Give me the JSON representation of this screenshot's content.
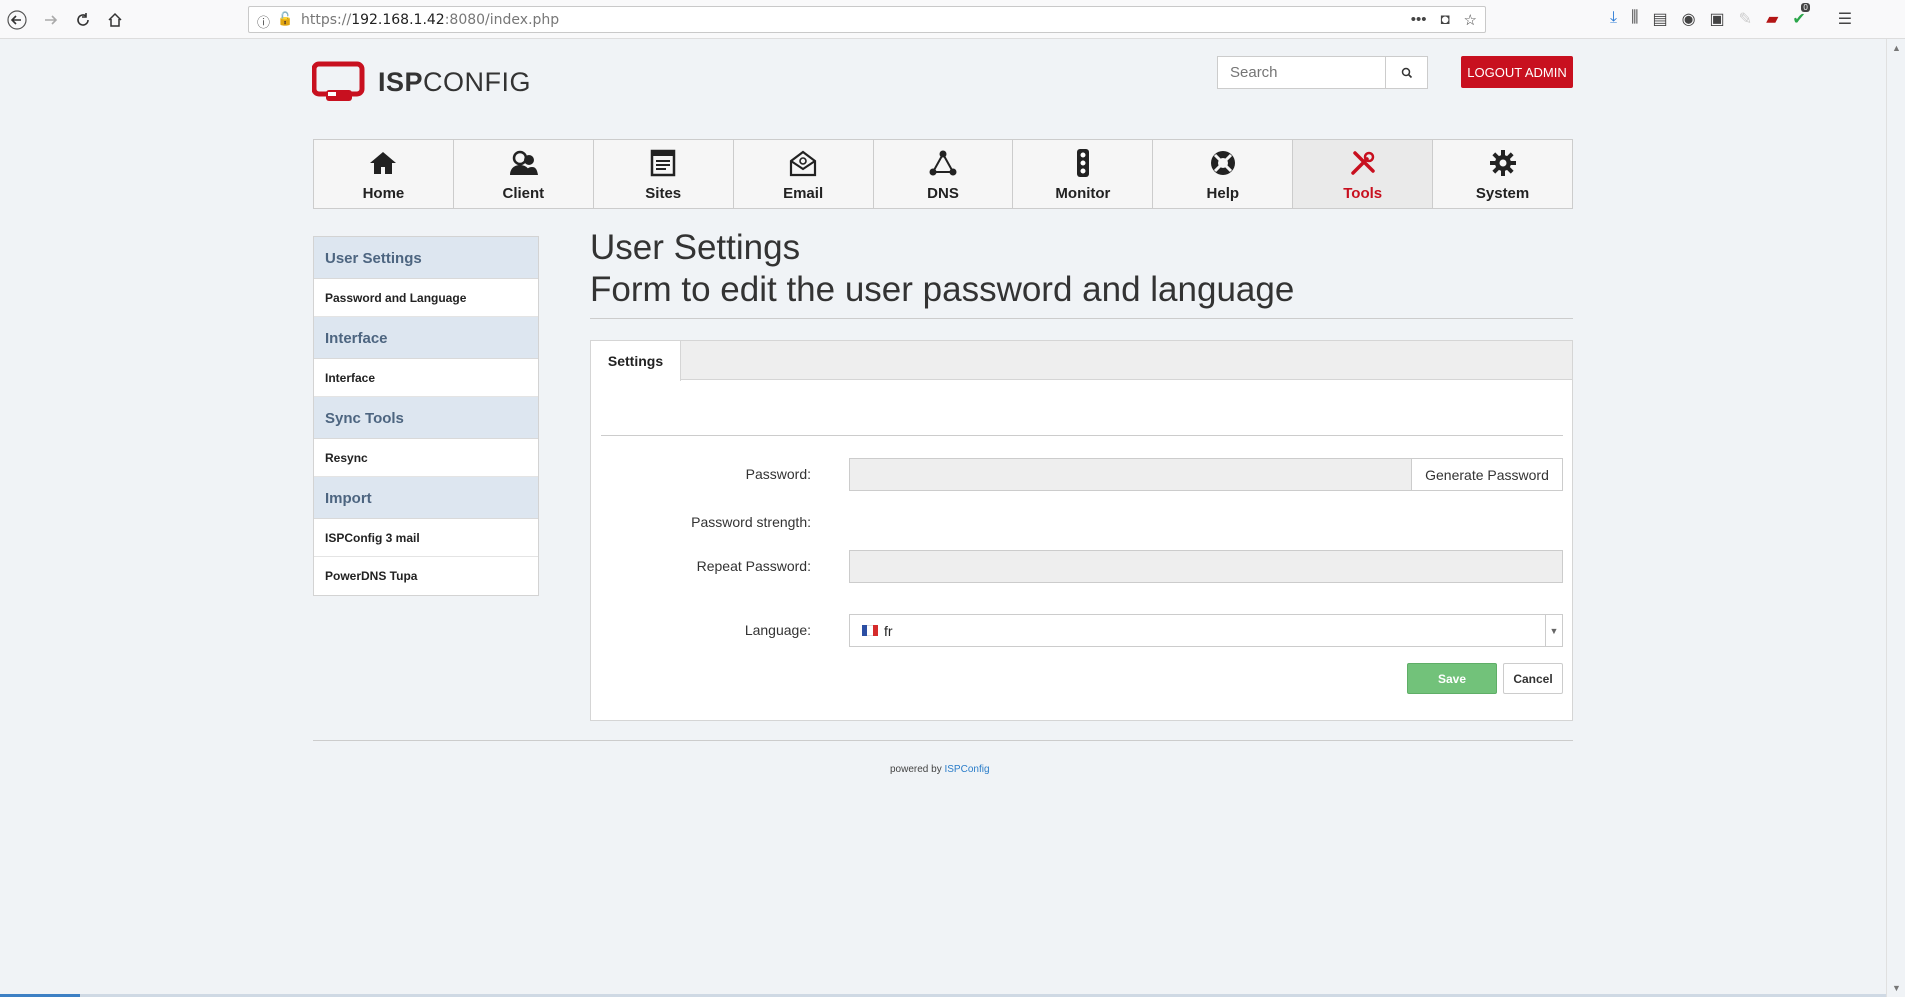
{
  "browser": {
    "url_scheme": "https://",
    "url_host": "192.168.1.42",
    "url_rest": ":8080/index.php",
    "toolbar_badge": "0"
  },
  "header": {
    "logo_bold": "ISP",
    "logo_light": "CONFIG",
    "search_placeholder": "Search",
    "logout_label": "LOGOUT ADMIN"
  },
  "mainnav": [
    {
      "label": "Home",
      "icon": "home-icon"
    },
    {
      "label": "Client",
      "icon": "client-icon"
    },
    {
      "label": "Sites",
      "icon": "sites-icon"
    },
    {
      "label": "Email",
      "icon": "email-icon"
    },
    {
      "label": "DNS",
      "icon": "dns-icon"
    },
    {
      "label": "Monitor",
      "icon": "monitor-icon"
    },
    {
      "label": "Help",
      "icon": "help-icon"
    },
    {
      "label": "Tools",
      "icon": "tools-icon",
      "active": true
    },
    {
      "label": "System",
      "icon": "gear-icon"
    }
  ],
  "sidebar": {
    "sections": [
      {
        "heading": "User Settings",
        "items": [
          "Password and Language"
        ]
      },
      {
        "heading": "Interface",
        "items": [
          "Interface"
        ]
      },
      {
        "heading": "Sync Tools",
        "items": [
          "Resync"
        ]
      },
      {
        "heading": "Import",
        "items": [
          "ISPConfig 3 mail",
          "PowerDNS Tupa"
        ]
      }
    ]
  },
  "page": {
    "title": "User Settings",
    "subtitle": "Form to edit the user password and language"
  },
  "form": {
    "tab_label": "Settings",
    "password_label": "Password:",
    "password_value": "",
    "generate_label": "Generate Password",
    "strength_label": "Password strength:",
    "repeat_label": "Repeat Password:",
    "repeat_value": "",
    "language_label": "Language:",
    "language_value": "fr",
    "save_label": "Save",
    "cancel_label": "Cancel"
  },
  "footer": {
    "prefix": "powered by",
    "link": "ISPConfig"
  },
  "colors": {
    "brand_red": "#c8101f",
    "save_green": "#72c27a",
    "sidebar_heading_bg": "#dde6f0",
    "link_blue": "#2b7dc9"
  }
}
